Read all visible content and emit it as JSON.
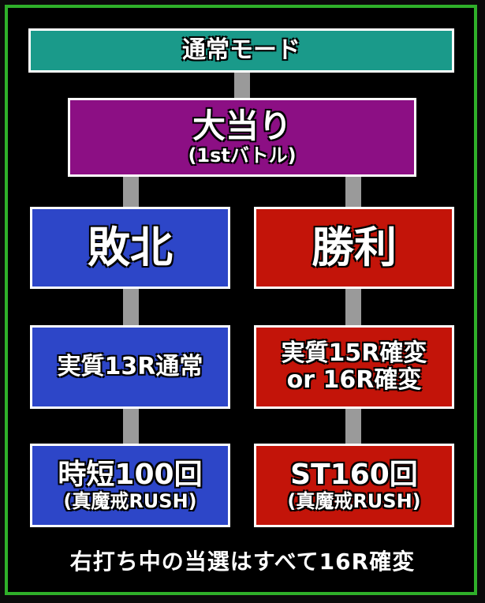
{
  "colors": {
    "frame_border": "#2fb02a",
    "mode_box": "#1a9a8a",
    "jackpot_box": "#8c0f84",
    "lose_branch": "#2d46c8",
    "win_branch": "#c31409",
    "connector": "#9a9a9a"
  },
  "flow": {
    "mode": "通常モード",
    "jackpot": {
      "title": "大当り",
      "subtitle": "(1stバトル)"
    },
    "lose": {
      "result": "敗北",
      "jackpot_type": "実質13R通常",
      "next_mode": "時短100回",
      "next_mode_sub": "(真魔戒RUSH)"
    },
    "win": {
      "result": "勝利",
      "jackpot_type_1": "実質15R確変",
      "jackpot_type_2": "or 16R確変",
      "next_mode": "ST160回",
      "next_mode_sub": "(真魔戒RUSH)"
    }
  },
  "footer_note": "右打ち中の当選はすべて16R確変"
}
